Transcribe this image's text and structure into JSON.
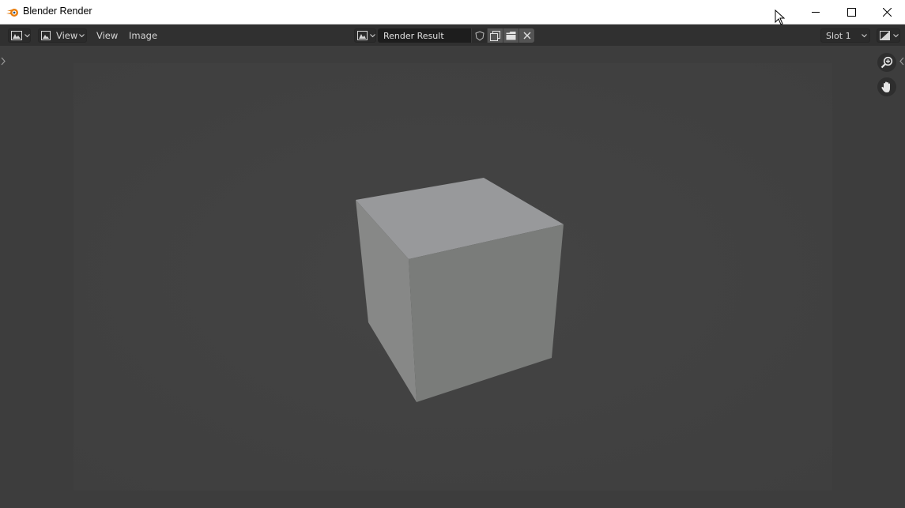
{
  "window": {
    "title": "Blender Render",
    "controls": [
      "minimize",
      "maximize",
      "close"
    ]
  },
  "header": {
    "editor_type_icon": "image-editor-icon",
    "view_mode_label": "View",
    "menus": [
      "View",
      "Image"
    ],
    "image_browse_icon": "image-browse-icon",
    "image_name": "Render Result",
    "image_buttons": [
      "fake-user-shield-icon",
      "new-image-icon",
      "open-image-icon",
      "unlink-x-icon"
    ],
    "slot_value": "Slot 1",
    "display_channels_icon": "display-channels-icon"
  },
  "viewport": {
    "tools": [
      "zoom-icon",
      "pan-hand-icon"
    ],
    "render_content": "grey-cube"
  },
  "colors": {
    "title_bar": "#ffffff",
    "header": "#303030",
    "viewport_bg": "#3d3d3d",
    "render_bg": "#434343",
    "cube_top": "#98999b",
    "cube_front": "#7a7c7a",
    "cube_left": "#888989",
    "blender_orange": "#e87d0d"
  }
}
